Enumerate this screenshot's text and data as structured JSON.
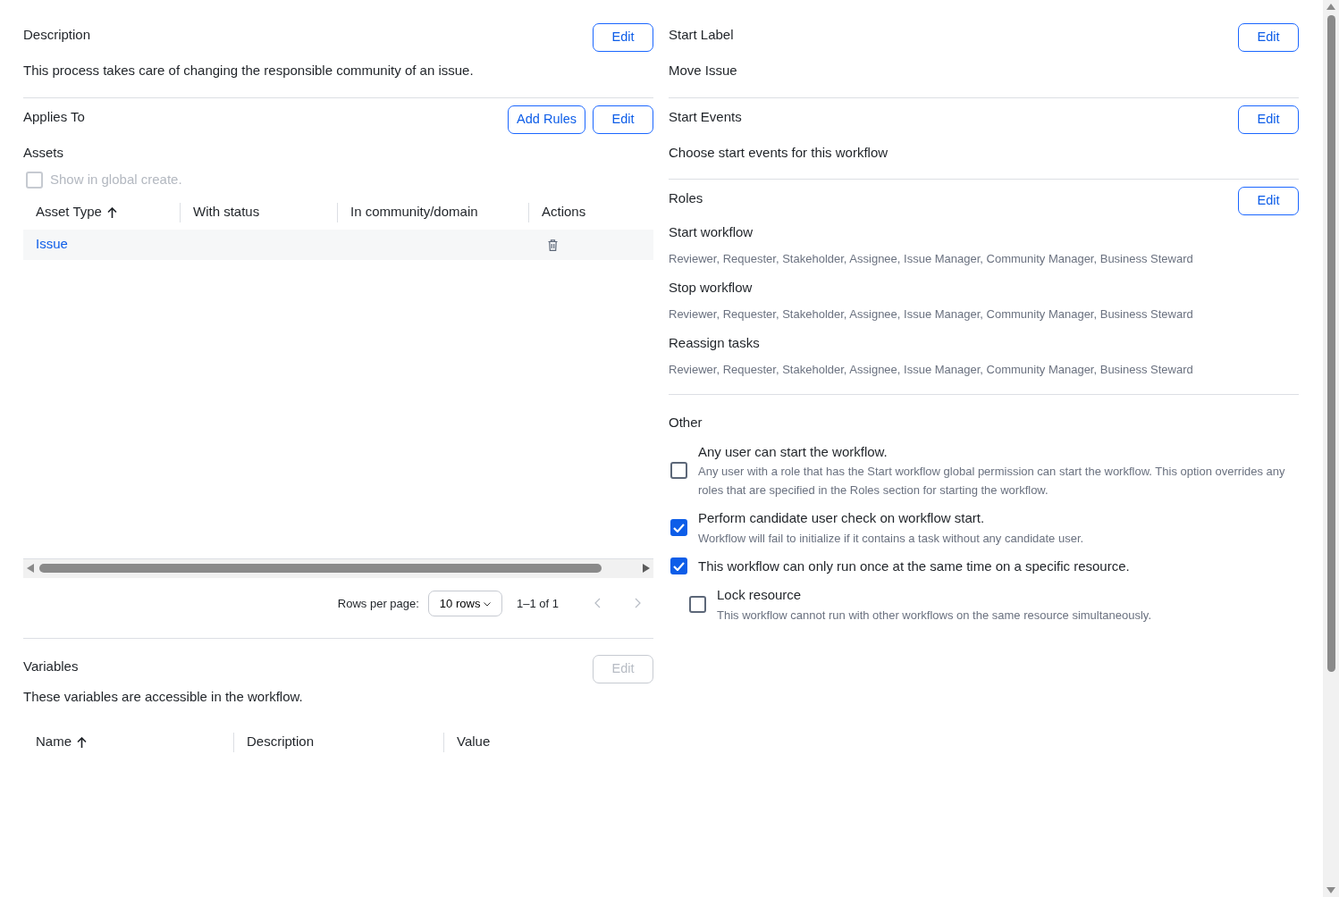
{
  "description": {
    "title": "Description",
    "buttons": [
      {
        "label": "Edit",
        "disabled": false
      }
    ],
    "text": "This process takes care of changing the responsible community of an issue."
  },
  "applies_to": {
    "title": "Applies To",
    "buttons": [
      {
        "label": "Add Rules",
        "disabled": false
      },
      {
        "label": "Edit",
        "disabled": false
      }
    ],
    "subtitle": "Assets",
    "show_in_global_create": {
      "label": "Show in global create.",
      "checked": false,
      "disabled": true
    },
    "table": {
      "columns": [
        {
          "label": "Asset Type",
          "sorted_ascending": true
        },
        {
          "label": "With status",
          "sorted_ascending": false
        },
        {
          "label": "In community/domain",
          "sorted_ascending": false
        },
        {
          "label": "Actions",
          "sorted_ascending": false
        }
      ],
      "rows": [
        {
          "asset_type": "Issue",
          "deletable": true
        }
      ]
    },
    "pagination": {
      "label": "Rows per page:",
      "rows_select": "10 rows",
      "range": "1–1 of 1",
      "prev_disabled": true,
      "next_disabled": true
    }
  },
  "variables": {
    "title": "Variables",
    "buttons": [
      {
        "label": "Edit",
        "disabled": true
      }
    ],
    "text": "These variables are accessible in the workflow.",
    "table": {
      "columns": [
        {
          "label": "Name",
          "sorted_ascending": true
        },
        {
          "label": "Description",
          "sorted_ascending": false
        },
        {
          "label": "Value",
          "sorted_ascending": false
        }
      ]
    }
  },
  "start_label": {
    "title": "Start Label",
    "buttons": [
      {
        "label": "Edit",
        "disabled": false
      }
    ],
    "text": "Move Issue"
  },
  "start_events": {
    "title": "Start Events",
    "buttons": [
      {
        "label": "Edit",
        "disabled": false
      }
    ],
    "text": "Choose start events for this workflow"
  },
  "roles": {
    "title": "Roles",
    "buttons": [
      {
        "label": "Edit",
        "disabled": false
      }
    ],
    "groups": [
      {
        "name": "Start workflow",
        "roles": "Reviewer, Requester, Stakeholder, Assignee, Issue Manager, Community Manager, Business Steward"
      },
      {
        "name": "Stop workflow",
        "roles": "Reviewer, Requester, Stakeholder, Assignee, Issue Manager, Community Manager, Business Steward"
      },
      {
        "name": "Reassign tasks",
        "roles": "Reviewer, Requester, Stakeholder, Assignee, Issue Manager, Community Manager, Business Steward"
      }
    ]
  },
  "other": {
    "title": "Other",
    "options": [
      {
        "label": "Any user can start the workflow.",
        "help": "Any user with a role that has the Start workflow global permission can start the workflow. This option overrides any roles that are specified in the Roles section for starting the workflow.",
        "checked": false
      },
      {
        "label": "Perform candidate user check on workflow start.",
        "help": "Workflow will fail to initialize if it contains a task without any candidate user.",
        "checked": true
      },
      {
        "label": "This workflow can only run once at the same time on a specific resource.",
        "checked": true,
        "children": [
          {
            "label": "Lock resource",
            "help": "This workflow cannot run with other workflows on the same resource simultaneously.",
            "checked": false
          }
        ]
      }
    ]
  }
}
